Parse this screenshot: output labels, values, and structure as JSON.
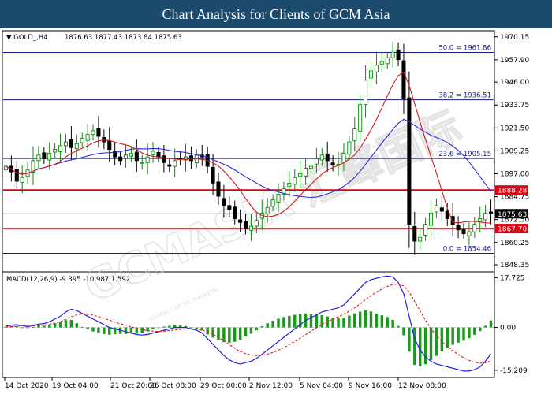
{
  "banner": {
    "title": "Chart Analysis for Clients of GCM Asia"
  },
  "chart_data": [
    {
      "type": "candlestick",
      "header": {
        "symbol": "GOLD_,H4",
        "ohlc": "1876.63 1877.43 1873.84 1875.63"
      },
      "ylim": [
        1845.0,
        1973.0
      ],
      "y_ticks": [
        "1970.15",
        "1957.90",
        "1946.00",
        "1933.75",
        "1921.50",
        "1909.25",
        "1897.00",
        "1884.75",
        "1872.50",
        "1860.25",
        "1848.35"
      ],
      "x_ticks": [
        "14 Oct 2020",
        "19 Oct 04:00",
        "21 Oct 20:00",
        "26 Oct 08:00",
        "29 Oct 00:00",
        "2 Nov 12:00",
        "5 Nov 04:00",
        "9 Nov 16:00",
        "12 Nov 08:00"
      ],
      "fib_levels": [
        {
          "label": "50.0 = 1961.86",
          "value": 1961.86
        },
        {
          "label": "38.2 = 1936.51",
          "value": 1936.51
        },
        {
          "label": "23.6 = 1905.15",
          "value": 1905.15
        },
        {
          "label": "0.0 = 1854.46",
          "value": 1854.46
        }
      ],
      "sr_levels": [
        {
          "label": "1888.28",
          "value": 1888.28
        },
        {
          "label": "1867.70",
          "value": 1867.7
        }
      ],
      "current_price": {
        "label": "1875.63",
        "value": 1875.63
      },
      "colors": {
        "ma_fast": "#cc1f1f",
        "ma_slow": "#2a2adc",
        "fib_line": "#1a1a8a",
        "sr_line": "#dd0011",
        "bull": "#0a8a0a",
        "bear": "#000000"
      },
      "closes": [
        1901,
        1898,
        1893,
        1895,
        1899,
        1904,
        1907,
        1905,
        1908,
        1910,
        1912,
        1914,
        1911,
        1913,
        1916,
        1918,
        1920,
        1917,
        1914,
        1910,
        1906,
        1904,
        1907,
        1908,
        1904,
        1903,
        1906,
        1909,
        1906,
        1903,
        1901,
        1904,
        1905,
        1906,
        1904,
        1907,
        1906,
        1901,
        1892,
        1885,
        1880,
        1878,
        1873,
        1871,
        1868,
        1869,
        1872,
        1876,
        1879,
        1883,
        1886,
        1889,
        1892,
        1895,
        1897,
        1900,
        1901,
        1905,
        1907,
        1904,
        1902,
        1902,
        1908,
        1914,
        1921,
        1934,
        1947,
        1952,
        1955,
        1957,
        1959,
        1962,
        1958,
        1937,
        1870,
        1861,
        1863,
        1870,
        1876,
        1880,
        1877,
        1873,
        1870,
        1867,
        1865,
        1866,
        1870,
        1873,
        1876,
        1876
      ]
    },
    {
      "type": "line",
      "header": {
        "label": "MACD(12,26,9) -9.395 -10.987 1.592"
      },
      "ylim": [
        -17.5,
        19.5
      ],
      "y_ticks": [
        "17.725",
        "0.00",
        "-15.209"
      ],
      "series": [
        {
          "name": "MACD",
          "values": [
            0.5,
            0.8,
            1,
            0.6,
            0.3,
            0.6,
            1.2,
            1.4,
            2,
            3,
            4,
            5.5,
            6.5,
            6,
            5,
            4,
            3,
            2,
            1,
            0,
            -0.5,
            -1,
            -1.5,
            -2,
            -2.5,
            -2.7,
            -2.5,
            -2,
            -1.5,
            -1,
            -0.5,
            0,
            0,
            0,
            -0.5,
            -1,
            -2,
            -4,
            -6,
            -8,
            -10,
            -11.5,
            -12.5,
            -13,
            -12.5,
            -12,
            -11,
            -9.5,
            -8,
            -6.5,
            -5,
            -3.5,
            -2,
            -0.5,
            1,
            2.5,
            3.5,
            4.5,
            5.5,
            6,
            6.5,
            7,
            8,
            10,
            12,
            14,
            16,
            17,
            17.5,
            18,
            18.3,
            18,
            16,
            12,
            4,
            -4,
            -8,
            -10.5,
            -12,
            -13,
            -13.5,
            -14,
            -14.5,
            -15,
            -15.5,
            -15.5,
            -15,
            -14,
            -12,
            -9.4
          ]
        },
        {
          "name": "Signal",
          "values": [
            0.2,
            0.3,
            0.5,
            0.6,
            0.5,
            0.5,
            0.6,
            0.8,
            1.1,
            1.5,
            2.1,
            2.9,
            3.8,
            4.5,
            4.8,
            4.7,
            4.4,
            3.9,
            3.3,
            2.6,
            1.9,
            1.3,
            0.8,
            0.2,
            -0.3,
            -0.8,
            -1.1,
            -1.3,
            -1.4,
            -1.3,
            -1.1,
            -0.9,
            -0.7,
            -0.5,
            -0.5,
            -0.6,
            -0.9,
            -1.5,
            -2.4,
            -3.5,
            -4.8,
            -6.1,
            -7.4,
            -8.5,
            -9.3,
            -9.8,
            -10,
            -9.9,
            -9.5,
            -8.9,
            -8.1,
            -7.2,
            -6.1,
            -5,
            -3.8,
            -2.5,
            -1.3,
            -0.1,
            1.1,
            2.1,
            3,
            3.8,
            4.7,
            5.8,
            7,
            8.4,
            9.9,
            11.3,
            12.6,
            13.7,
            14.6,
            15.3,
            15.5,
            14.8,
            12.6,
            9.3,
            5.9,
            2.6,
            -0.4,
            -2.9,
            -5,
            -6.8,
            -8.3,
            -9.6,
            -10.8,
            -11.7,
            -12.4,
            -12.7,
            -12.6,
            -11.9
          ]
        }
      ]
    }
  ],
  "watermark": {
    "text": "GCMASIA 汇峰国际",
    "subtext": "GLOBAL CAPITAL MARKETS"
  }
}
